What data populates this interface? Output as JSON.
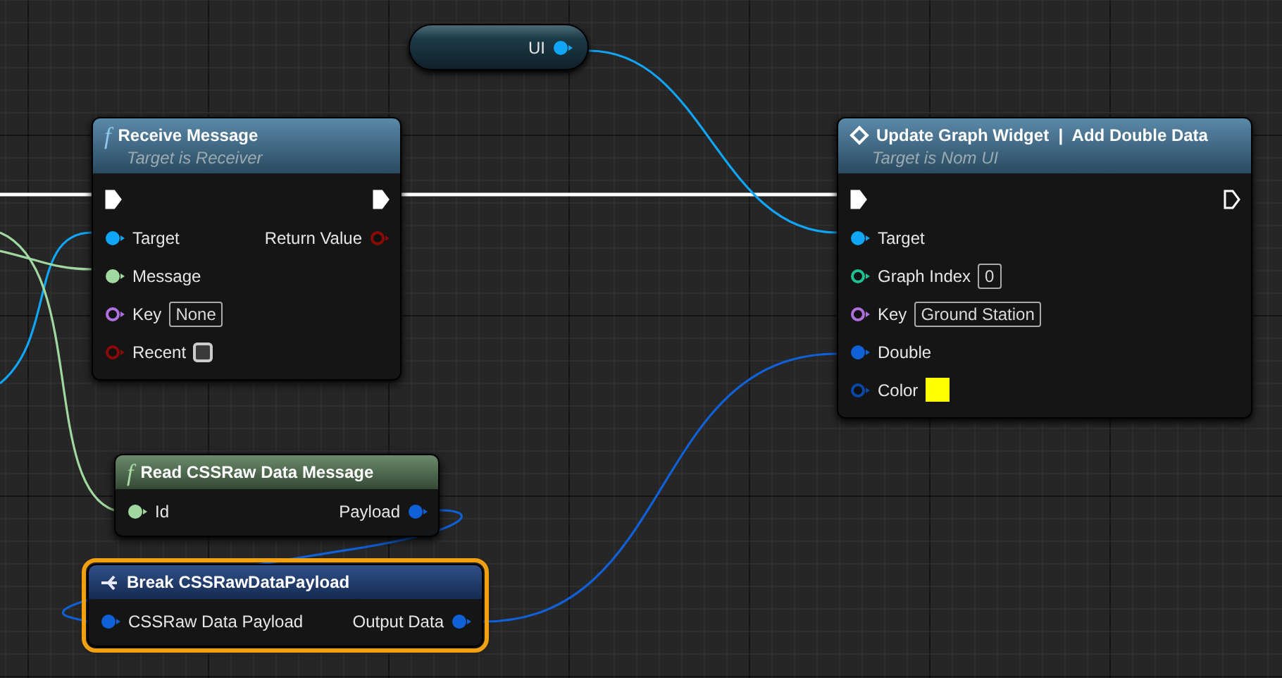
{
  "nodes": [
    {
      "kind": "variable",
      "selected": false,
      "rows": [
        {
          "out": {
            "label": "UI",
            "kind": "object",
            "connected": true
          }
        }
      ]
    },
    {
      "kind": "function",
      "selected": false,
      "icon": "f",
      "title": "Receive Message",
      "subtitle": "Target is Receiver",
      "rows": [
        {
          "in": {
            "kind": "exec",
            "connected": true
          },
          "out": {
            "kind": "exec",
            "connected": true
          }
        },
        {
          "in": {
            "label": "Target",
            "kind": "object",
            "connected": true
          },
          "out": {
            "label": "Return Value",
            "kind": "bool",
            "connected": false
          }
        },
        {
          "in": {
            "label": "Message",
            "kind": "message",
            "connected": true
          }
        },
        {
          "in": {
            "label": "Key",
            "kind": "name",
            "connected": false,
            "value": "None"
          }
        },
        {
          "in": {
            "label": "Recent",
            "kind": "bool",
            "connected": false,
            "checked": false
          }
        }
      ]
    },
    {
      "kind": "message",
      "selected": false,
      "title": "Update Graph Widget  |  Add Double Data",
      "subtitle": "Target is Nom UI",
      "rows": [
        {
          "in": {
            "kind": "exec",
            "connected": true
          },
          "out": {
            "kind": "exec",
            "connected": false
          }
        },
        {
          "in": {
            "label": "Target",
            "kind": "object",
            "connected": true
          }
        },
        {
          "in": {
            "label": "Graph Index",
            "kind": "int",
            "connected": false,
            "value": "0"
          }
        },
        {
          "in": {
            "label": "Key",
            "kind": "name",
            "connected": false,
            "value": "Ground Station"
          }
        },
        {
          "in": {
            "label": "Double",
            "kind": "double",
            "connected": true
          }
        },
        {
          "in": {
            "label": "Color",
            "kind": "color",
            "connected": false,
            "color": "#ffff00"
          }
        }
      ]
    },
    {
      "kind": "pure",
      "selected": false,
      "icon": "f",
      "title": "Read CSSRaw Data Message",
      "rows": [
        {
          "in": {
            "label": "Id",
            "kind": "message",
            "connected": true
          },
          "out": {
            "label": "Payload",
            "kind": "double",
            "connected": true
          }
        }
      ]
    },
    {
      "kind": "break",
      "selected": true,
      "title": "Break CSSRawDataPayload",
      "rows": [
        {
          "in": {
            "label": "CSSRaw Data Payload",
            "kind": "double",
            "connected": true
          },
          "out": {
            "label": "Output Data",
            "kind": "double",
            "connected": true
          }
        }
      ]
    }
  ]
}
